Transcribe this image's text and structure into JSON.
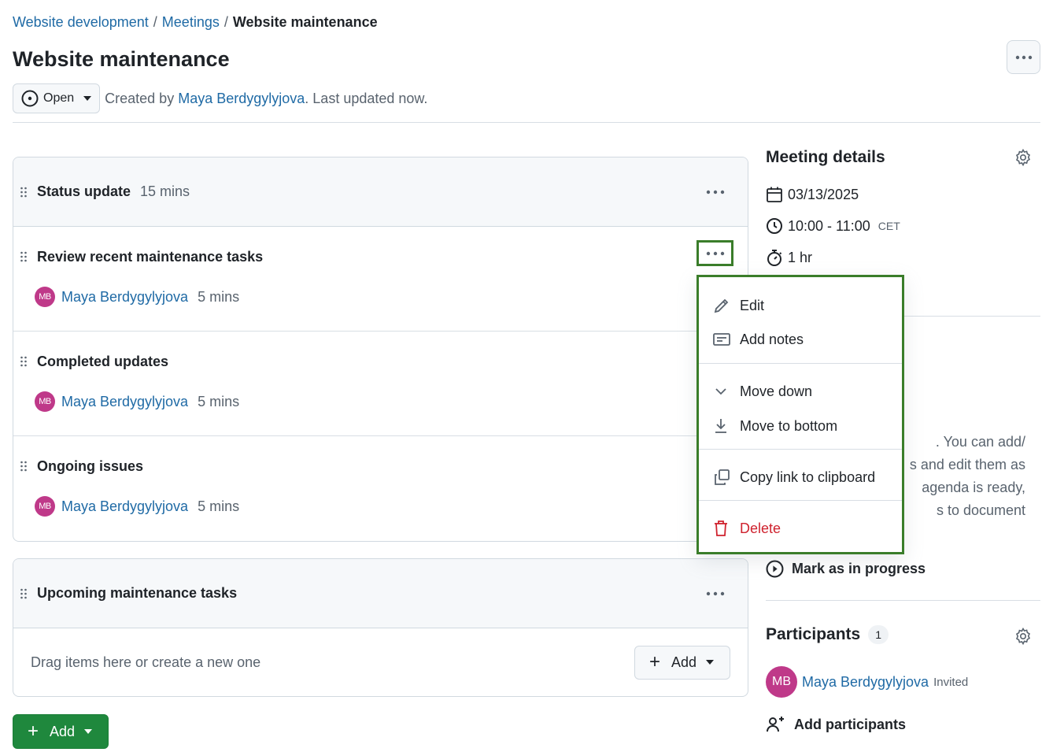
{
  "breadcrumb": {
    "items": [
      "Website development",
      "Meetings"
    ],
    "current": "Website maintenance",
    "separator": "/"
  },
  "header": {
    "title": "Website maintenance",
    "status": "Open",
    "created_by_prefix": "Created by",
    "created_by_user": "Maya Berdygylyjova",
    "updated_text": ". Last updated now."
  },
  "sections": [
    {
      "title": "Status update",
      "duration": "15 mins",
      "items": [
        {
          "title": "Review recent maintenance tasks",
          "presenter": "Maya Berdygylyjova",
          "initials": "MB",
          "duration": "5 mins"
        },
        {
          "title": "Completed updates",
          "presenter": "Maya Berdygylyjova",
          "initials": "MB",
          "duration": "5 mins"
        },
        {
          "title": "Ongoing issues",
          "presenter": "Maya Berdygylyjova",
          "initials": "MB",
          "duration": "5 mins"
        }
      ]
    },
    {
      "title": "Upcoming maintenance tasks",
      "duration": "",
      "empty_text": "Drag items here or create a new one",
      "add_label": "Add"
    }
  ],
  "main_add_label": "Add",
  "context_menu": {
    "items": [
      {
        "label": "Edit",
        "icon": "pencil-icon"
      },
      {
        "label": "Add notes",
        "icon": "note-icon"
      },
      {
        "label": "Move down",
        "icon": "chevron-down-icon"
      },
      {
        "label": "Move to bottom",
        "icon": "move-to-bottom-icon"
      },
      {
        "label": "Copy link to clipboard",
        "icon": "copy-icon"
      },
      {
        "label": "Delete",
        "icon": "trash-icon"
      }
    ]
  },
  "meeting_details": {
    "title": "Meeting details",
    "date": "03/13/2025",
    "time": "10:00 - 11:00",
    "timezone": "CET",
    "duration": "1 hr",
    "description_lines": [
      ". You can add/",
      "s and edit them as",
      "agenda is ready,",
      "s to document"
    ],
    "mark_in_progress": "Mark as in progress"
  },
  "participants": {
    "title": "Participants",
    "count": "1",
    "list": [
      {
        "name": "Maya Berdygylyjova",
        "initials": "MB",
        "status": "Invited"
      }
    ],
    "add_label": "Add participants"
  },
  "colors": {
    "link": "#1f6aa5",
    "avatar": "#bf3989",
    "primary_button": "#1f883d",
    "danger": "#cf222e",
    "highlight_border": "#3a7d2a"
  }
}
